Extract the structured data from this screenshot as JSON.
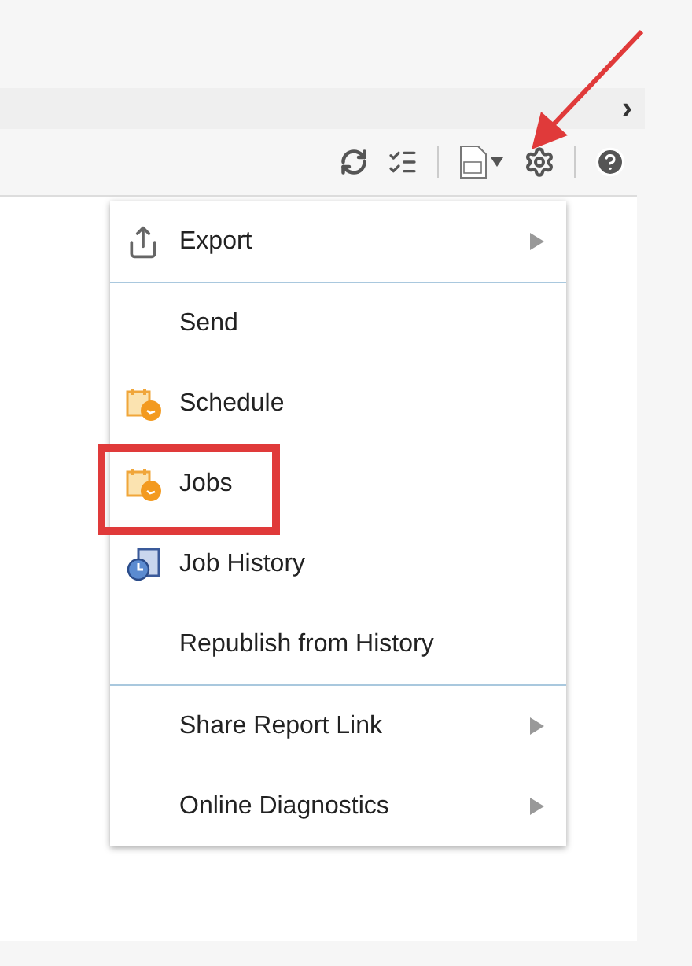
{
  "breadcrumb_bar": {
    "chevron": "›"
  },
  "menu": {
    "items": [
      {
        "label": "Export",
        "kind": "export",
        "submenu": true,
        "divider_after": true,
        "highlighted": false
      },
      {
        "label": "Send",
        "kind": "plain",
        "submenu": false,
        "divider_after": false,
        "highlighted": false
      },
      {
        "label": "Schedule",
        "kind": "schedule",
        "submenu": false,
        "divider_after": false,
        "highlighted": false
      },
      {
        "label": "Jobs",
        "kind": "schedule",
        "submenu": false,
        "divider_after": false,
        "highlighted": true
      },
      {
        "label": "Job History",
        "kind": "history",
        "submenu": false,
        "divider_after": false,
        "highlighted": false
      },
      {
        "label": "Republish from History",
        "kind": "plain",
        "submenu": false,
        "divider_after": true,
        "highlighted": false
      },
      {
        "label": "Share Report Link",
        "kind": "plain",
        "submenu": true,
        "divider_after": false,
        "highlighted": false
      },
      {
        "label": "Online Diagnostics",
        "kind": "plain",
        "submenu": true,
        "divider_after": false,
        "highlighted": false
      }
    ]
  }
}
